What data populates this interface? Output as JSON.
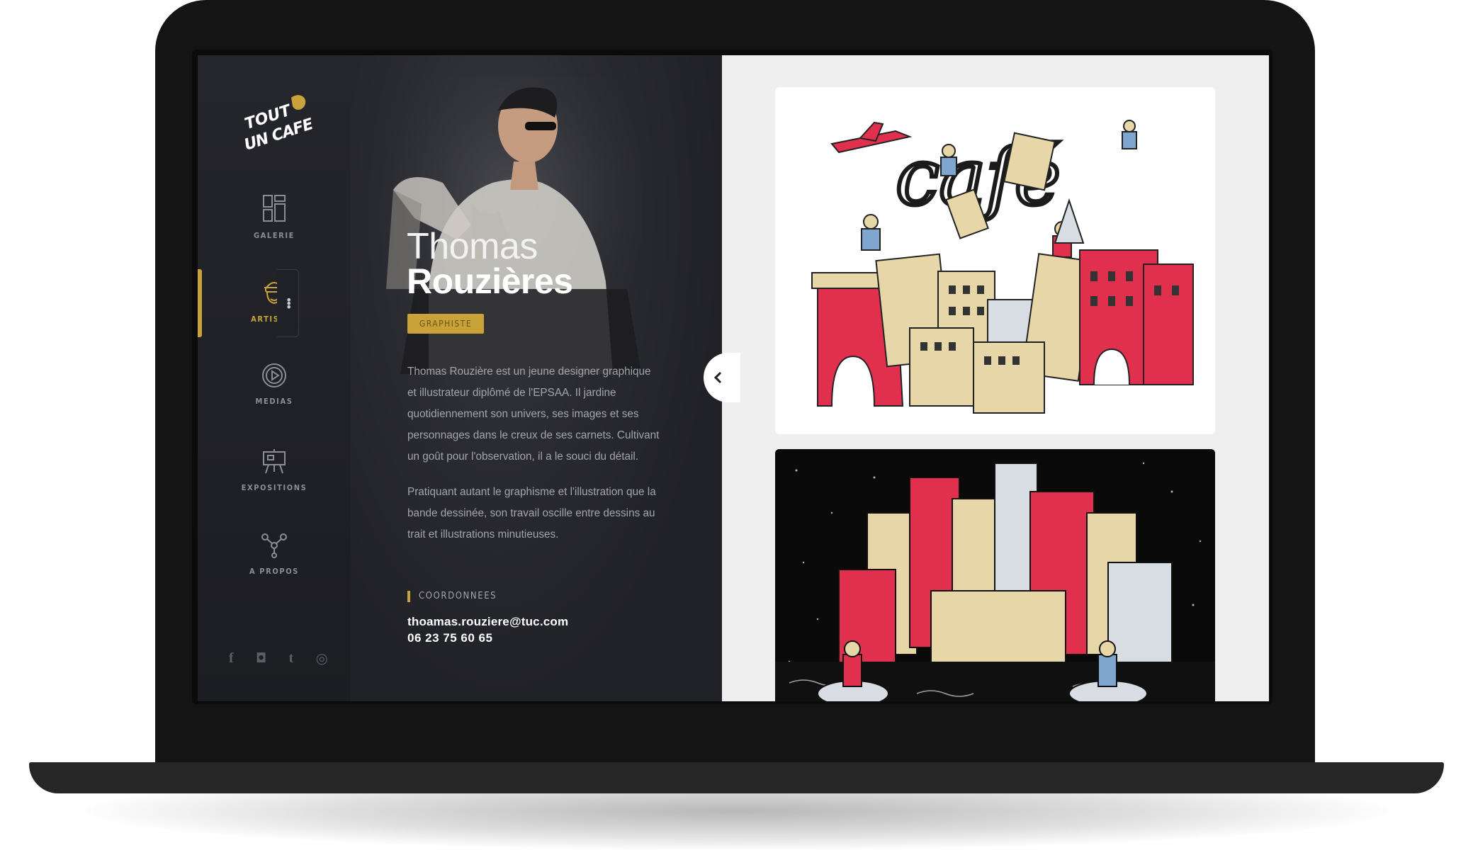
{
  "logo": {
    "line1": "TOUT",
    "line2": "UN CAFE"
  },
  "nav": {
    "items": [
      {
        "label": "GALERIE",
        "icon": "gallery-icon"
      },
      {
        "label": "ARTISTES",
        "icon": "artist-icon"
      },
      {
        "label": "MEDIAS",
        "icon": "play-icon"
      },
      {
        "label": "EXPOSITIONS",
        "icon": "easel-icon"
      },
      {
        "label": "A PROPOS",
        "icon": "network-icon"
      }
    ],
    "active_index": 1
  },
  "social": {
    "facebook": "f",
    "instagram": "◘",
    "tumblr": "t",
    "dribbble": "◎"
  },
  "artist": {
    "first_name": "Thomas",
    "last_name": "Rouzières",
    "role": "GRAPHISTE",
    "bio_1": "Thomas Rouzière est un jeune designer graphique et illustrateur diplômé de l'EPSAA. Il jardine quotidiennement son univers, ses images et ses personnages dans le creux de ses carnets. Cultivant un goût pour l'observation, il a le souci du détail.",
    "bio_2": "Pratiquant autant le graphisme et l'illustration que la bande dessinée, son travail oscille entre dessins au trait et illustrations minutieuses.",
    "contact_heading": "COORDONNEES",
    "email": "thoamas.rouziere@tuc.com",
    "phone": "06 23 75 60 65"
  },
  "gallery": {
    "artwork_1_text": "café"
  },
  "colors": {
    "accent": "#c9a33a",
    "sidebar_bg": "#25262c",
    "panel_bg": "#2a2b31",
    "gallery_bg": "#efefef",
    "illustration_red": "#e0304e",
    "illustration_beige": "#e7d7a8"
  }
}
